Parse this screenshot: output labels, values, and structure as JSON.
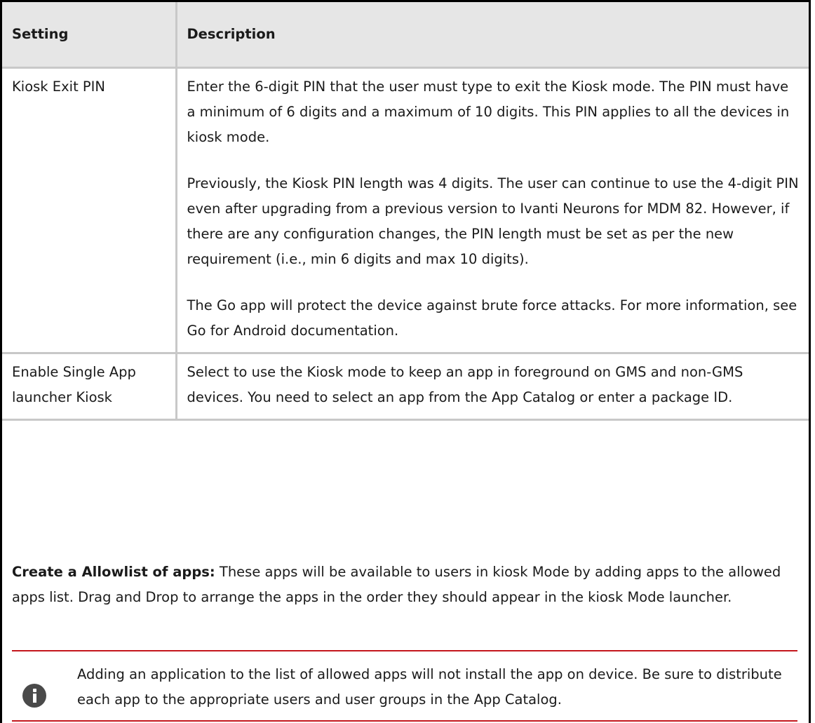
{
  "table": {
    "headers": {
      "setting": "Setting",
      "description": "Description"
    },
    "rows": [
      {
        "setting": "Kiosk Exit PIN",
        "description": [
          "Enter the 6-digit PIN that the user must type to exit the Kiosk mode. The PIN must have a minimum of 6 digits and a maximum of 10 digits. This PIN applies to all the devices in kiosk mode.",
          "Previously, the Kiosk PIN length was 4 digits. The user can continue to use the 4-digit PIN even after upgrading from a previous version to Ivanti Neurons for MDM 82. However, if there are any configuration changes, the PIN length must be set as per the new requirement (i.e., min 6 digits and max 10 digits).",
          "The Go app will protect the device against brute force attacks. For more information, see Go for Android documentation."
        ]
      },
      {
        "setting": "Enable Single App launcher Kiosk",
        "description": [
          "Select to use the Kiosk mode to keep an app in foreground on GMS and non-GMS devices. You need to select an app from the App Catalog or enter a package ID."
        ]
      }
    ]
  },
  "allowlist": {
    "heading": "Create a Allowlist of apps:",
    "text": " These apps will be available to users in kiosk Mode by adding apps to the allowed apps list. Drag and Drop to arrange the apps in the order they should appear in the kiosk Mode launcher."
  },
  "note": {
    "icon": "info-icon",
    "text": "Adding an application to the list of allowed apps will not install the app on device. Be sure to distribute each app to the appropriate users and user groups in the App Catalog."
  },
  "colors": {
    "header_bg": "#e6e6e6",
    "grid": "#c8c8c8",
    "note_rule": "#c4161c",
    "icon": "#4a4a4a"
  }
}
